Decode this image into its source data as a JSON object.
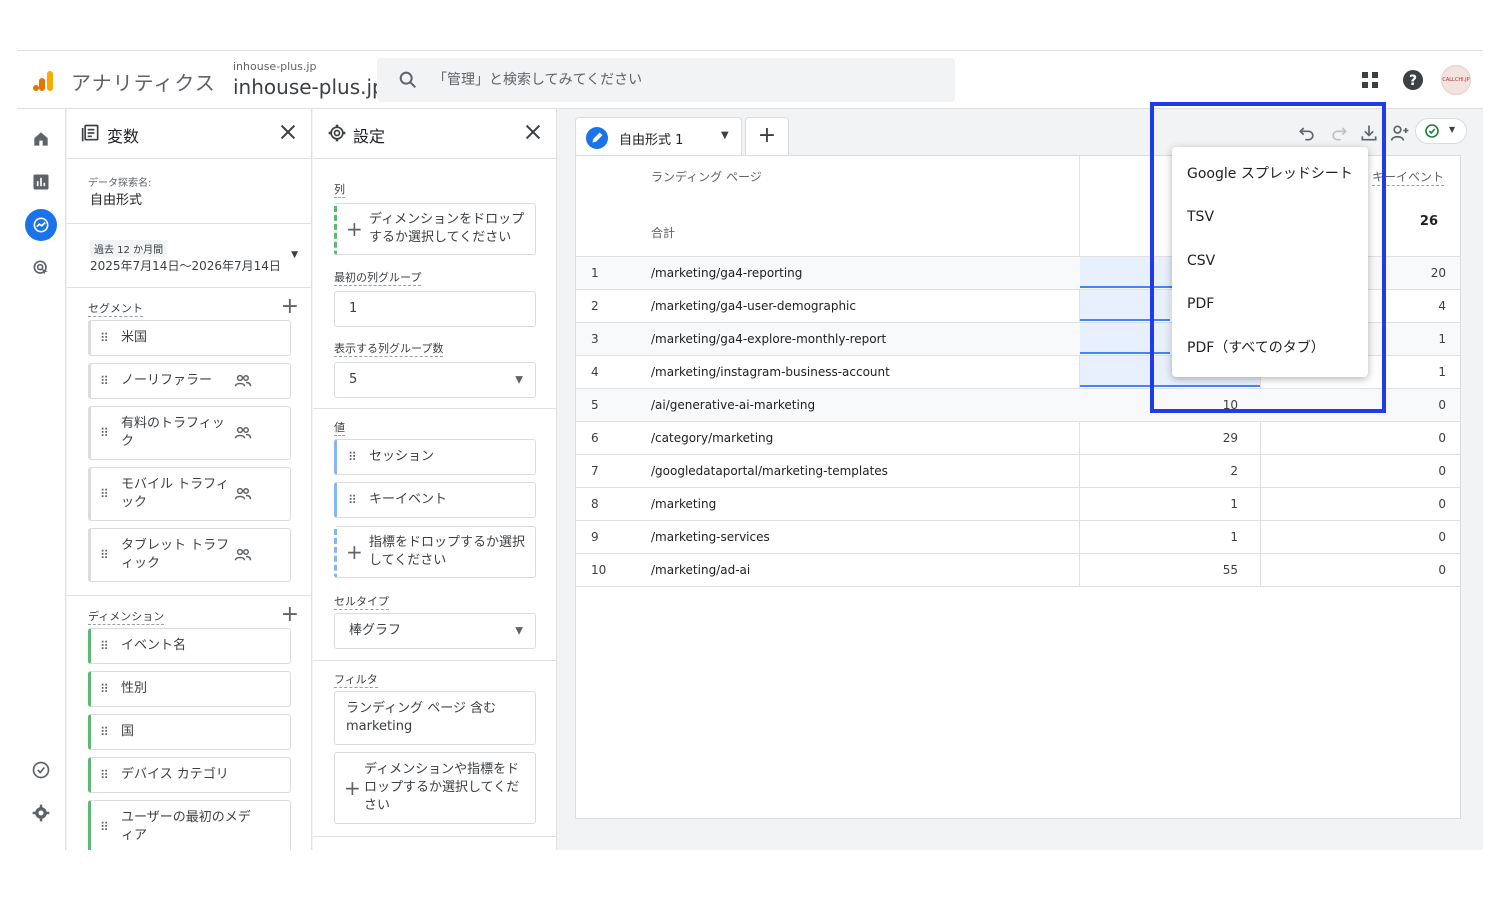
{
  "header": {
    "app_name": "アナリティクス",
    "account_small": "inhouse-plus.jp",
    "account_big": "inhouse-plus.jp",
    "search_placeholder": "「管理」と検索してみてください",
    "avatar_text": "CALLCHI.JP"
  },
  "variables_panel": {
    "title": "変数",
    "exploration_label": "データ探索名:",
    "exploration_name": "自由形式",
    "date_range_label": "過去 12 か月間",
    "date_range": "2025年7月14日〜2026年7月14日",
    "segments_label": "セグメント",
    "segments": [
      {
        "label": "米国",
        "audience": false
      },
      {
        "label": "ノーリファラー",
        "audience": true
      },
      {
        "label": "有料のトラフィック",
        "audience": true
      },
      {
        "label": "モバイル トラフィック",
        "audience": true
      },
      {
        "label": "タブレット トラフィック",
        "audience": true
      }
    ],
    "dimensions_label": "ディメンション",
    "dimensions": [
      "イベント名",
      "性別",
      "国",
      "デバイス カテゴリ",
      "ユーザーの最初のメディア"
    ]
  },
  "settings_panel": {
    "title": "設定",
    "columns_label": "列",
    "columns_drop": "ディメンションをドロップするか選択してください",
    "first_col_group_label": "最初の列グループ",
    "first_col_group_value": "1",
    "shown_col_groups_label": "表示する列グループ数",
    "shown_col_groups_value": "5",
    "values_label": "値",
    "values": [
      "セッション",
      "キーイベント"
    ],
    "values_drop": "指標をドロップするか選択してください",
    "cell_type_label": "セルタイプ",
    "cell_type_value": "棒グラフ",
    "filters_label": "フィルタ",
    "filter_value": "ランディング ページ 含む marketing",
    "filters_drop": "ディメンションや指標をドロップするか選択してください"
  },
  "tabs": {
    "active": "自由形式 1",
    "add": "+"
  },
  "table": {
    "dimension_header": "ランディング ページ",
    "total_label": "合計",
    "keyevent_header": "キーイベント",
    "keyevent_total": "26",
    "rows": [
      {
        "idx": "1",
        "page": "/marketing/ga4-reporting",
        "sessions": "",
        "keyevents": "20",
        "bar": 1.0
      },
      {
        "idx": "2",
        "page": "/marketing/ga4-user-demographic",
        "sessions": "",
        "keyevents": "4",
        "bar": 0.5
      },
      {
        "idx": "3",
        "page": "/marketing/ga4-explore-monthly-report",
        "sessions": "",
        "keyevents": "1",
        "bar": 0.5
      },
      {
        "idx": "4",
        "page": "/marketing/instagram-business-account",
        "sessions": "",
        "keyevents": "1",
        "bar": 1.0
      },
      {
        "idx": "5",
        "page": "/ai/generative-ai-marketing",
        "sessions": "10",
        "keyevents": "0",
        "bar": 0
      },
      {
        "idx": "6",
        "page": "/category/marketing",
        "sessions": "29",
        "keyevents": "0",
        "bar": 0
      },
      {
        "idx": "7",
        "page": "/googledataportal/marketing-templates",
        "sessions": "2",
        "keyevents": "0",
        "bar": 0
      },
      {
        "idx": "8",
        "page": "/marketing",
        "sessions": "1",
        "keyevents": "0",
        "bar": 0
      },
      {
        "idx": "9",
        "page": "/marketing-services",
        "sessions": "1",
        "keyevents": "0",
        "bar": 0
      },
      {
        "idx": "10",
        "page": "/marketing/ad-ai",
        "sessions": "55",
        "keyevents": "0",
        "bar": 0
      }
    ]
  },
  "export_menu": {
    "items": [
      "Google スプレッドシート",
      "TSV",
      "CSV",
      "PDF",
      "PDF（すべてのタブ）"
    ]
  },
  "colors": {
    "accent": "#1a73e8",
    "highlight_box": "#1f3bea",
    "green_chip": "#5bb974",
    "bar_fill": "#e8f0fe"
  }
}
